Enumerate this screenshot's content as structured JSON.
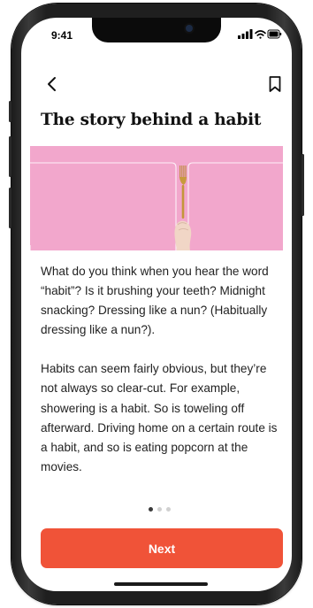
{
  "status_bar": {
    "time": "9:41"
  },
  "article": {
    "title": "The story behind a habit",
    "paragraphs": [
      "What do you think when you hear the word “habit”? Is it brushing your teeth? Midnight snacking? Dressing like a nun? (Habitually dressing like a nun?).",
      "Habits can seem fairly obvious, but they’re not always so clear-cut. For example, showering is a habit. So is toweling off afterward. Driving home on a certain route is a habit, and so is eating popcorn at the movies."
    ]
  },
  "pagination": {
    "current_page": 1,
    "total_pages": 3
  },
  "actions": {
    "next_label": "Next"
  },
  "colors": {
    "accent": "#f05338",
    "hero_background": "#f2a7cc",
    "text": "#222222"
  }
}
